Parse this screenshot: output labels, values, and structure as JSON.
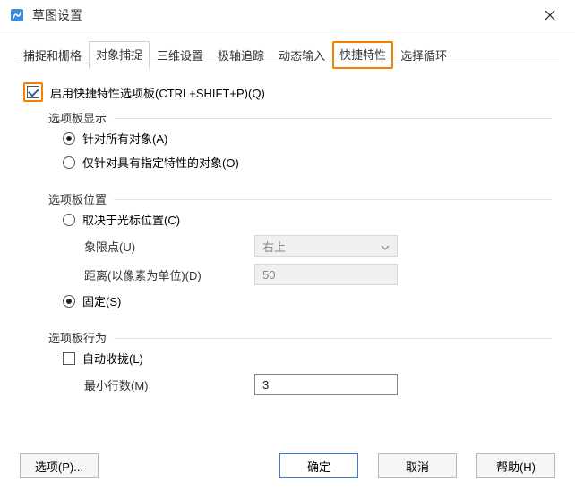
{
  "window": {
    "title": "草图设置"
  },
  "tabs": {
    "items": [
      "捕捉和栅格",
      "对象捕捉",
      "三维设置",
      "极轴追踪",
      "动态输入",
      "快捷特性",
      "选择循环"
    ]
  },
  "main_checkbox": {
    "label": "启用快捷特性选项板(CTRL+SHIFT+P)(Q)",
    "checked": true
  },
  "group_display": {
    "title": "选项板显示",
    "opt_all": "针对所有对象(A)",
    "opt_specific": "仅针对具有指定特性的对象(O)",
    "selected": "all"
  },
  "group_position": {
    "title": "选项板位置",
    "opt_cursor": "取决于光标位置(C)",
    "quadrant_label": "象限点(U)",
    "quadrant_value": "右上",
    "distance_label": "距离(以像素为单位)(D)",
    "distance_value": "50",
    "opt_fixed": "固定(S)",
    "selected": "fixed"
  },
  "group_behavior": {
    "title": "选项板行为",
    "auto_collapse": "自动收拢(L)",
    "auto_collapse_checked": false,
    "min_rows_label": "最小行数(M)",
    "min_rows_value": "3"
  },
  "footer": {
    "options": "选项(P)...",
    "ok": "确定",
    "cancel": "取消",
    "help": "帮助(H)"
  }
}
